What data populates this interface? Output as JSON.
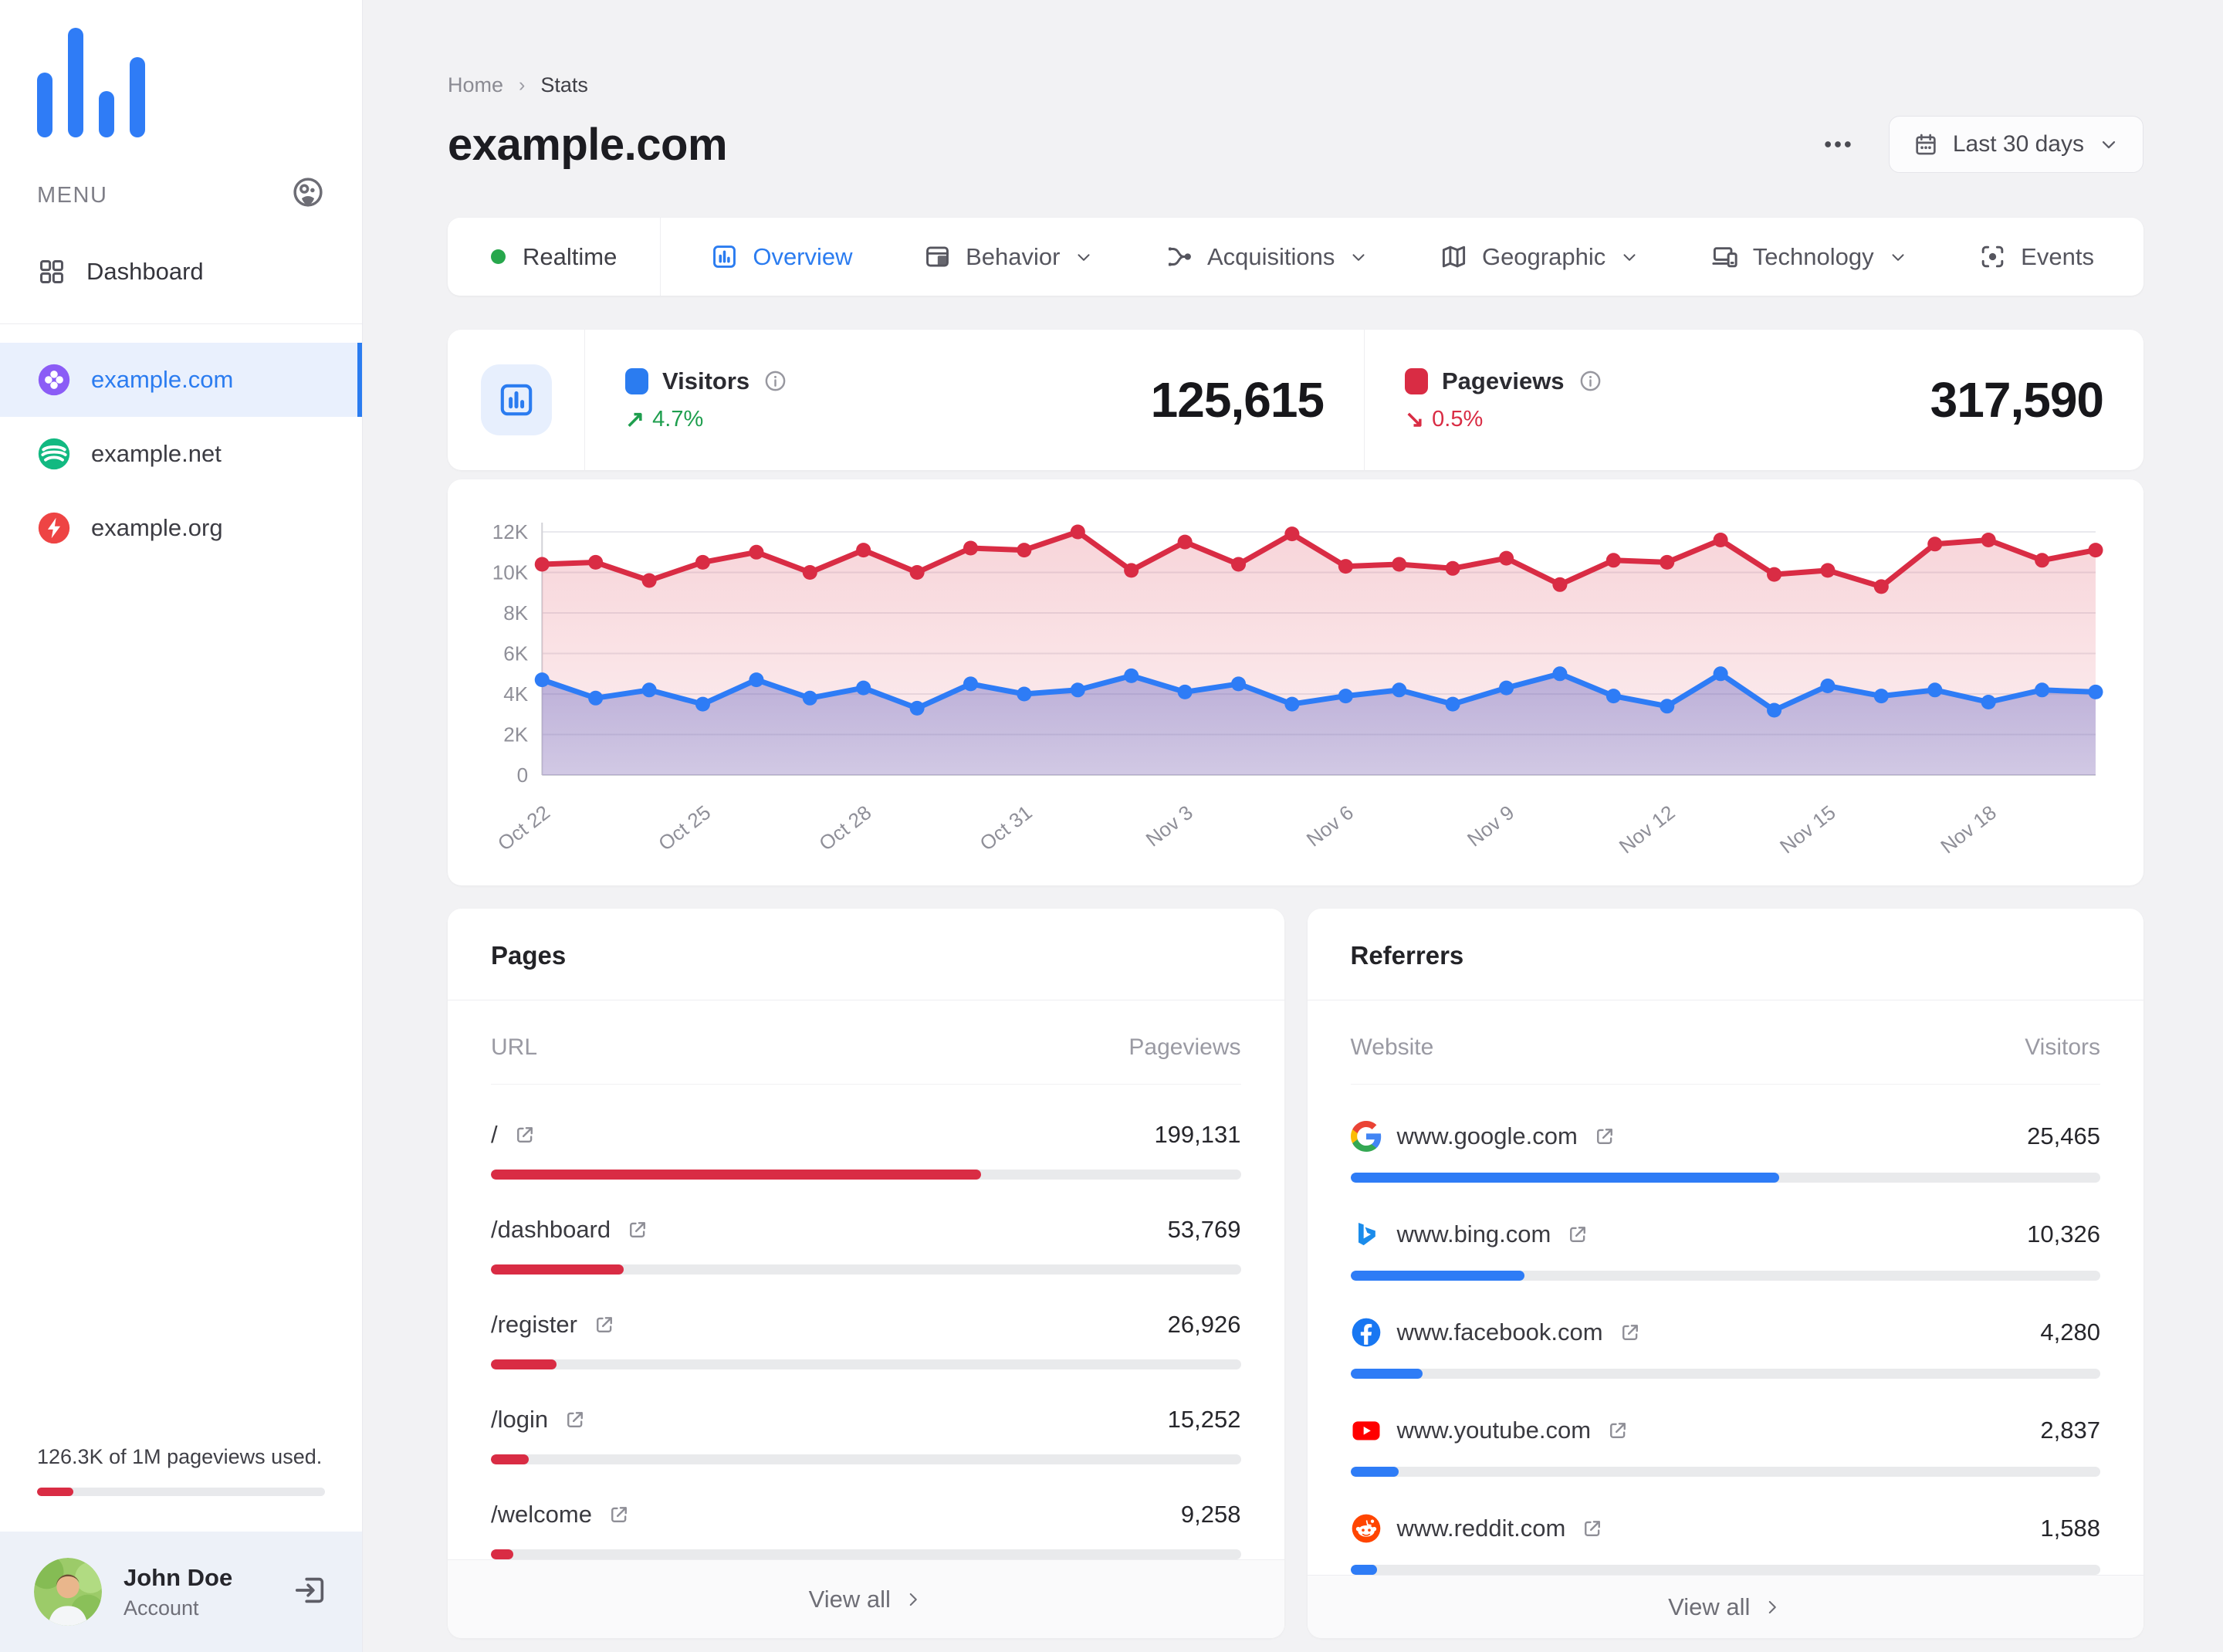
{
  "accent": {
    "blue": "#2b7cf0",
    "red": "#d92c44",
    "green": "#1e9e4e"
  },
  "sidebar": {
    "menu_label": "MENU",
    "dashboard_label": "Dashboard",
    "sites": [
      {
        "label": "example.com",
        "icon": "site-clover",
        "color": "#8b5cf6",
        "active": true
      },
      {
        "label": "example.net",
        "icon": "site-waves",
        "color": "#12b981",
        "active": false
      },
      {
        "label": "example.org",
        "icon": "site-bolt",
        "color": "#ee4444",
        "active": false
      }
    ],
    "usage": {
      "text": "126.3K of 1M pageviews used.",
      "pct": 12.6
    },
    "account": {
      "name": "John Doe",
      "role": "Account"
    }
  },
  "header": {
    "breadcrumb": [
      "Home",
      "Stats"
    ],
    "title": "example.com",
    "date_range": "Last 30 days"
  },
  "tabs": {
    "realtime_label": "Realtime",
    "items": [
      {
        "label": "Overview",
        "icon": "overview",
        "active": true,
        "dropdown": false
      },
      {
        "label": "Behavior",
        "icon": "behavior",
        "active": false,
        "dropdown": true
      },
      {
        "label": "Acquisitions",
        "icon": "acquisitions",
        "active": false,
        "dropdown": true
      },
      {
        "label": "Geographic",
        "icon": "geographic",
        "active": false,
        "dropdown": true
      },
      {
        "label": "Technology",
        "icon": "technology",
        "active": false,
        "dropdown": true
      },
      {
        "label": "Events",
        "icon": "events",
        "active": false,
        "dropdown": false
      }
    ]
  },
  "stats": {
    "visitors": {
      "label": "Visitors",
      "value": "125,615",
      "delta": "4.7%",
      "direction": "up",
      "swatch": "#2b7cf0"
    },
    "pageviews": {
      "label": "Pageviews",
      "value": "317,590",
      "delta": "0.5%",
      "direction": "down",
      "swatch": "#d92c44"
    }
  },
  "chart_data": {
    "type": "area",
    "ylim": [
      0,
      12000
    ],
    "ytick_step": 2000,
    "grid": true,
    "x": [
      "Oct 22",
      "Oct 23",
      "Oct 24",
      "Oct 25",
      "Oct 26",
      "Oct 27",
      "Oct 28",
      "Oct 29",
      "Oct 30",
      "Oct 31",
      "Nov 1",
      "Nov 2",
      "Nov 3",
      "Nov 4",
      "Nov 5",
      "Nov 6",
      "Nov 7",
      "Nov 8",
      "Nov 9",
      "Nov 10",
      "Nov 11",
      "Nov 12",
      "Nov 13",
      "Nov 14",
      "Nov 15",
      "Nov 16",
      "Nov 17",
      "Nov 18",
      "Nov 19",
      "Nov 20"
    ],
    "x_tick_every": 3,
    "legend_position": "none",
    "series": [
      {
        "name": "Pageviews",
        "color": "#d92c44",
        "fill_top": "rgba(217,44,68,0.20)",
        "fill_bottom": "rgba(217,44,68,0.07)",
        "values": [
          10400,
          10500,
          9600,
          10500,
          11000,
          10000,
          11100,
          10000,
          11200,
          11100,
          12000,
          10100,
          11500,
          10400,
          11900,
          10300,
          10400,
          10200,
          10700,
          9400,
          10600,
          10500,
          11600,
          9900,
          10100,
          9300,
          11400,
          11600,
          10600,
          11100
        ]
      },
      {
        "name": "Visitors",
        "color": "#2e7cf6",
        "fill_top": "rgba(86,88,190,0.38)",
        "fill_bottom": "rgba(86,88,190,0.26)",
        "values": [
          4700,
          3800,
          4200,
          3500,
          4700,
          3800,
          4300,
          3300,
          4500,
          4000,
          4200,
          4900,
          4100,
          4500,
          3500,
          3900,
          4200,
          3500,
          4300,
          5000,
          3900,
          3400,
          5000,
          3200,
          4400,
          3900,
          4200,
          3600,
          4200,
          4100
        ]
      }
    ]
  },
  "pages_card": {
    "title": "Pages",
    "col_left": "URL",
    "col_right": "Pageviews",
    "bar_color": "#d92c44",
    "view_all": "View all",
    "rows": [
      {
        "label": "/",
        "value": 199131,
        "value_display": "199,131"
      },
      {
        "label": "/dashboard",
        "value": 53769,
        "value_display": "53,769"
      },
      {
        "label": "/register",
        "value": 26926,
        "value_display": "26,926"
      },
      {
        "label": "/login",
        "value": 15252,
        "value_display": "15,252"
      },
      {
        "label": "/welcome",
        "value": 9258,
        "value_display": "9,258"
      }
    ]
  },
  "referrers_card": {
    "title": "Referrers",
    "col_left": "Website",
    "col_right": "Visitors",
    "bar_color": "#2e7cf6",
    "view_all": "View all",
    "rows": [
      {
        "label": "www.google.com",
        "icon": "google-favicon",
        "value": 25465,
        "value_display": "25,465"
      },
      {
        "label": "www.bing.com",
        "icon": "bing-favicon",
        "value": 10326,
        "value_display": "10,326"
      },
      {
        "label": "www.facebook.com",
        "icon": "facebook-favicon",
        "value": 4280,
        "value_display": "4,280"
      },
      {
        "label": "www.youtube.com",
        "icon": "youtube-favicon",
        "value": 2837,
        "value_display": "2,837"
      },
      {
        "label": "www.reddit.com",
        "icon": "reddit-favicon",
        "value": 1588,
        "value_display": "1,588"
      }
    ]
  }
}
